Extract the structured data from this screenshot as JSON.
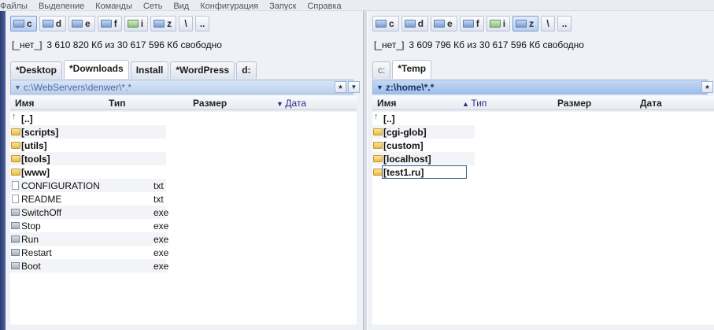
{
  "menu": [
    "Файлы",
    "Выделение",
    "Команды",
    "Сеть",
    "Вид",
    "Конфигурация",
    "Запуск",
    "Справка"
  ],
  "left": {
    "drives": [
      {
        "letter": "c",
        "active": true,
        "type": "local"
      },
      {
        "letter": "d",
        "active": false,
        "type": "local"
      },
      {
        "letter": "e",
        "active": false,
        "type": "local"
      },
      {
        "letter": "f",
        "active": false,
        "type": "local"
      },
      {
        "letter": "i",
        "active": false,
        "type": "net"
      },
      {
        "letter": "z",
        "active": false,
        "type": "local"
      }
    ],
    "tool_buttons": [
      "\\",
      ".."
    ],
    "disk_label": "[_нет_]",
    "disk_info": "3 610 820 Кб из 30 617 596 Кб свободно",
    "tabs": [
      {
        "label": "*Desktop",
        "active": false
      },
      {
        "label": "*Downloads",
        "active": true
      },
      {
        "label": "Install",
        "active": false
      },
      {
        "label": "*WordPress",
        "active": false
      },
      {
        "label": "d:",
        "active": false
      }
    ],
    "path": "c:\\WebServers\\denwer\\*.*",
    "columns": {
      "name": "Имя",
      "type": "Тип",
      "size": "Размер",
      "date": "Дата"
    },
    "sorted_column": "date",
    "sort_arrow": "▼",
    "files": [
      {
        "name": "[..]",
        "ext": "",
        "kind": "up"
      },
      {
        "name": "[scripts]",
        "ext": "",
        "kind": "dir"
      },
      {
        "name": "[utils]",
        "ext": "",
        "kind": "dir"
      },
      {
        "name": "[tools]",
        "ext": "",
        "kind": "dir"
      },
      {
        "name": "[www]",
        "ext": "",
        "kind": "dir"
      },
      {
        "name": "CONFIGURATION",
        "ext": "txt",
        "kind": "file"
      },
      {
        "name": "README",
        "ext": "txt",
        "kind": "file"
      },
      {
        "name": "SwitchOff",
        "ext": "exe",
        "kind": "exe"
      },
      {
        "name": "Stop",
        "ext": "exe",
        "kind": "exe"
      },
      {
        "name": "Run",
        "ext": "exe",
        "kind": "exe"
      },
      {
        "name": "Restart",
        "ext": "exe",
        "kind": "exe"
      },
      {
        "name": "Boot",
        "ext": "exe",
        "kind": "exe"
      }
    ]
  },
  "right": {
    "drives": [
      {
        "letter": "c",
        "active": false,
        "type": "local"
      },
      {
        "letter": "d",
        "active": false,
        "type": "local"
      },
      {
        "letter": "e",
        "active": false,
        "type": "local"
      },
      {
        "letter": "f",
        "active": false,
        "type": "local"
      },
      {
        "letter": "i",
        "active": false,
        "type": "net"
      },
      {
        "letter": "z",
        "active": true,
        "type": "local"
      }
    ],
    "tool_buttons": [
      "\\",
      ".."
    ],
    "disk_label": "[_нет_]",
    "disk_info": "3 609 796 Кб из 30 617 596 Кб свободно",
    "tabs": [
      {
        "label": "c:",
        "active": false
      },
      {
        "label": "*Temp",
        "active": true
      }
    ],
    "path": "z:\\home\\*.*",
    "columns": {
      "name": "Имя",
      "type": "Тип",
      "size": "Размер",
      "date": "Дата"
    },
    "sorted_column": "type",
    "sort_arrow": "▲",
    "files": [
      {
        "name": "[..]",
        "ext": "",
        "kind": "up"
      },
      {
        "name": "[cgi-glob]",
        "ext": "",
        "kind": "dir"
      },
      {
        "name": "[custom]",
        "ext": "",
        "kind": "dir"
      },
      {
        "name": "[localhost]",
        "ext": "",
        "kind": "dir"
      },
      {
        "name": "[test1.ru]",
        "ext": "",
        "kind": "dir",
        "renaming": true
      }
    ]
  },
  "colors": {
    "path_active": "#16315f",
    "path_inactive": "#4a6ca5",
    "folder": "#e6bb47"
  }
}
